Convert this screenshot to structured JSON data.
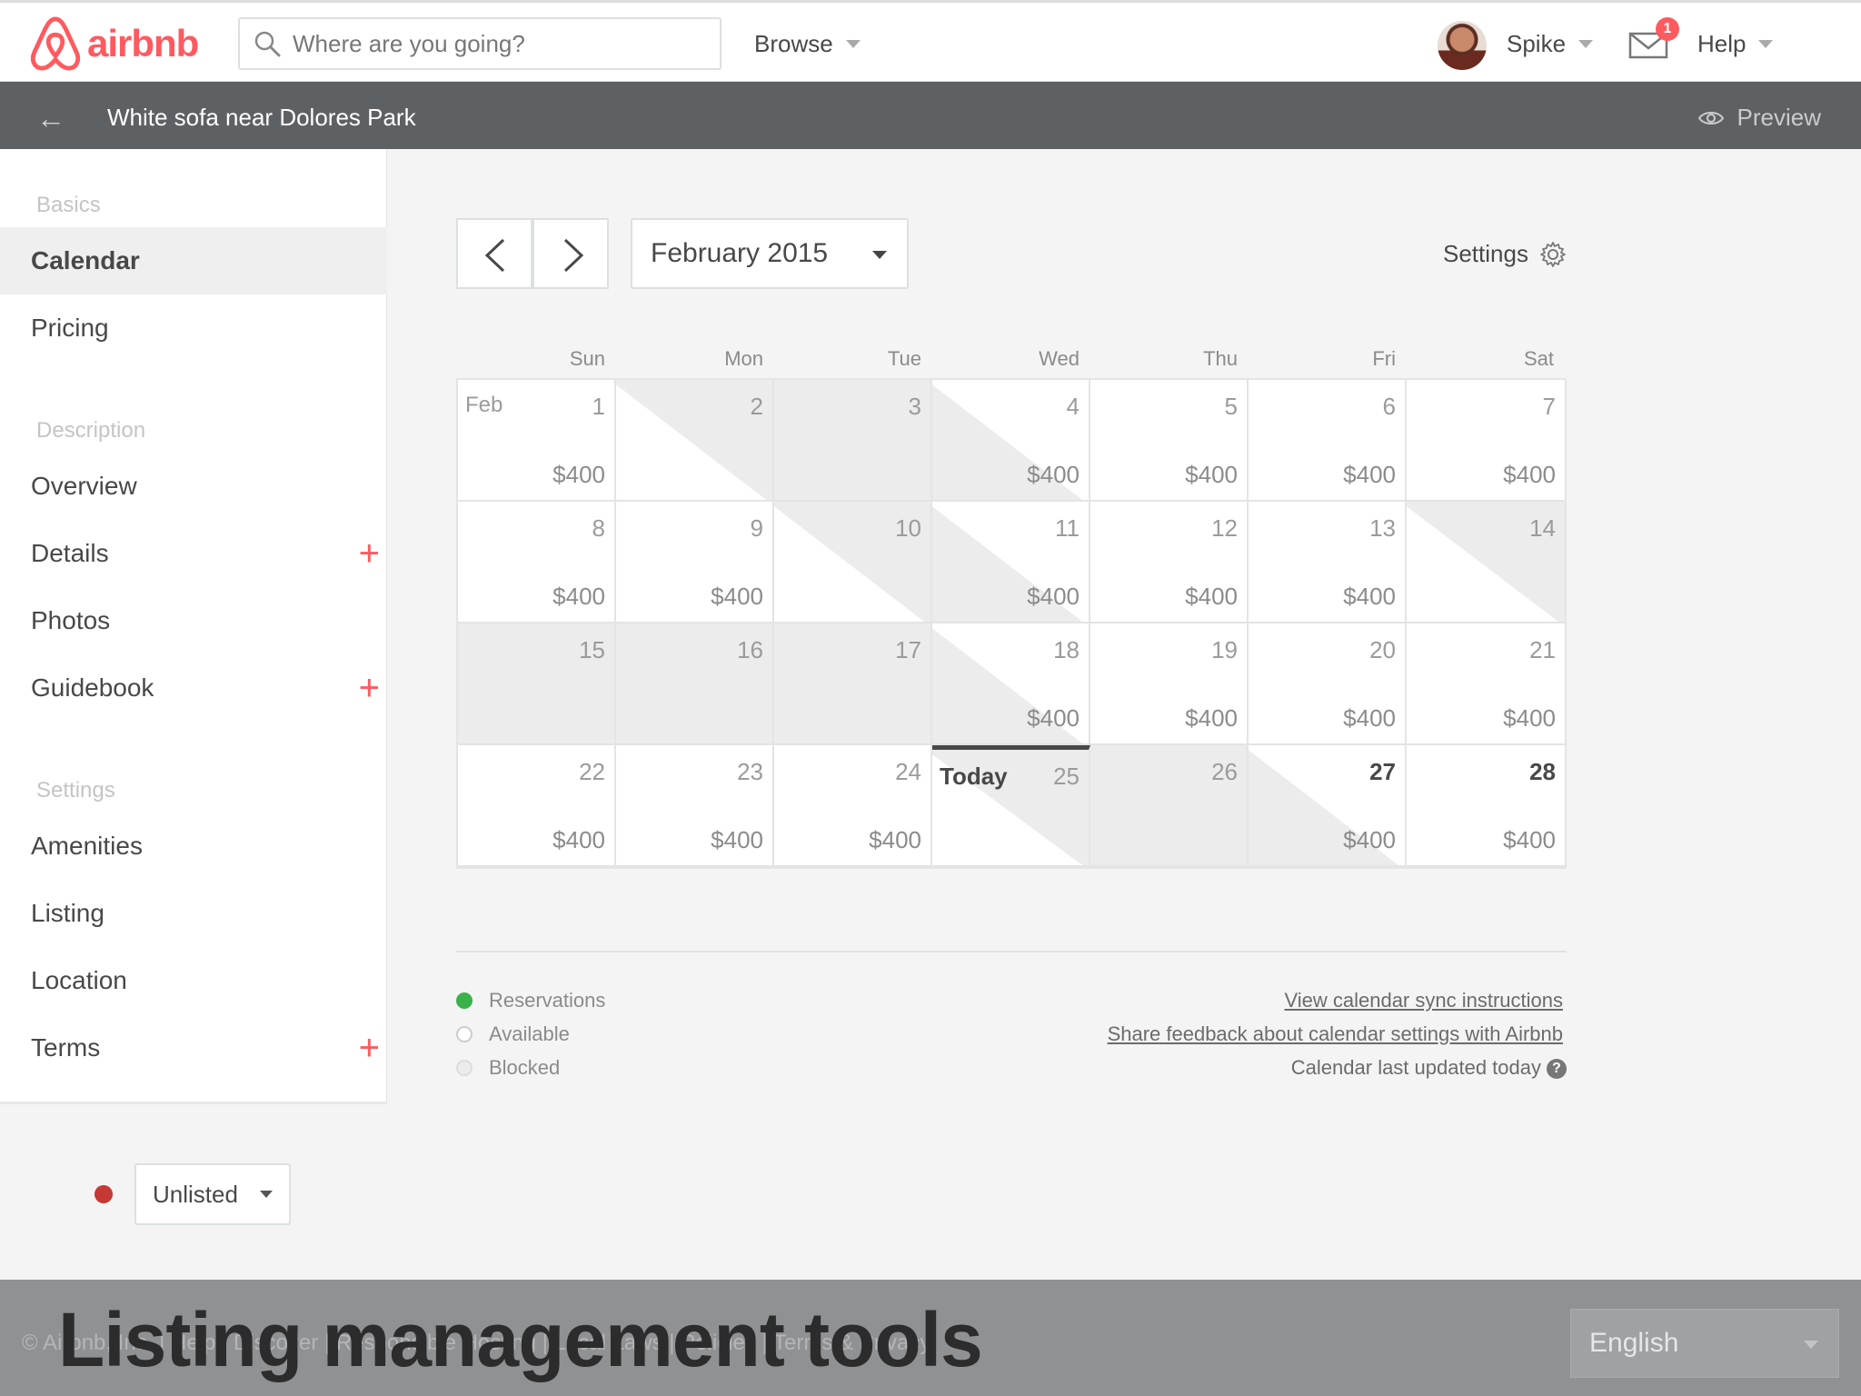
{
  "topnav": {
    "logo_text": "airbnb",
    "search_placeholder": "Where are you going?",
    "browse_label": "Browse",
    "user_name": "Spike",
    "mail_badge": "1",
    "help_label": "Help",
    "brand_color": "#ff5a5f"
  },
  "subheader": {
    "back_icon": "back-arrow-icon",
    "title": "White sofa near Dolores Park",
    "preview_label": "Preview"
  },
  "sidebar": {
    "sections": [
      {
        "heading": "Basics",
        "items": [
          "Calendar",
          "Pricing"
        ]
      },
      {
        "heading": "Description",
        "items": [
          "Overview",
          "Details",
          "Photos",
          "Guidebook"
        ]
      },
      {
        "heading": "Settings",
        "items": [
          "Amenities",
          "Listing",
          "Location",
          "Terms"
        ]
      }
    ],
    "active_item": "Calendar",
    "items_with_plus": [
      "Details",
      "Guidebook",
      "Terms"
    ],
    "status_label": "Unlisted",
    "status_color": "#c53834"
  },
  "calendar": {
    "month_label": "February 2015",
    "settings_label": "Settings",
    "weekdays": [
      "Sun",
      "Mon",
      "Tue",
      "Wed",
      "Thu",
      "Fri",
      "Sat"
    ],
    "month_abbrev": "Feb",
    "today_label": "Today",
    "days": [
      {
        "day": "1",
        "price": "$400",
        "state": "available"
      },
      {
        "day": "2",
        "price": "",
        "state": "diag-in"
      },
      {
        "day": "3",
        "price": "",
        "state": "blocked"
      },
      {
        "day": "4",
        "price": "$400",
        "state": "diag-out"
      },
      {
        "day": "5",
        "price": "$400",
        "state": "available"
      },
      {
        "day": "6",
        "price": "$400",
        "state": "available"
      },
      {
        "day": "7",
        "price": "$400",
        "state": "available"
      },
      {
        "day": "8",
        "price": "$400",
        "state": "available"
      },
      {
        "day": "9",
        "price": "$400",
        "state": "available"
      },
      {
        "day": "10",
        "price": "",
        "state": "diag-in"
      },
      {
        "day": "11",
        "price": "$400",
        "state": "diag-out"
      },
      {
        "day": "12",
        "price": "$400",
        "state": "available"
      },
      {
        "day": "13",
        "price": "$400",
        "state": "available"
      },
      {
        "day": "14",
        "price": "",
        "state": "diag-in"
      },
      {
        "day": "15",
        "price": "",
        "state": "blocked"
      },
      {
        "day": "16",
        "price": "",
        "state": "blocked"
      },
      {
        "day": "17",
        "price": "",
        "state": "blocked"
      },
      {
        "day": "18",
        "price": "$400",
        "state": "diag-out"
      },
      {
        "day": "19",
        "price": "$400",
        "state": "available"
      },
      {
        "day": "20",
        "price": "$400",
        "state": "available"
      },
      {
        "day": "21",
        "price": "$400",
        "state": "available"
      },
      {
        "day": "22",
        "price": "$400",
        "state": "available"
      },
      {
        "day": "23",
        "price": "$400",
        "state": "available"
      },
      {
        "day": "24",
        "price": "$400",
        "state": "available"
      },
      {
        "day": "25",
        "price": "",
        "state": "today"
      },
      {
        "day": "26",
        "price": "",
        "state": "blocked"
      },
      {
        "day": "27",
        "price": "$400",
        "state": "diag-out-bold"
      },
      {
        "day": "28",
        "price": "$400",
        "state": "bold"
      }
    ]
  },
  "legend": {
    "items": [
      {
        "label": "Reservations",
        "color": "#3ab24a"
      },
      {
        "label": "Available",
        "color": "#ffffff"
      },
      {
        "label": "Blocked",
        "color": "#ececec"
      }
    ],
    "sync_link": "View calendar sync instructions",
    "feedback_link": "Share feedback about calendar settings with Airbnb",
    "updated_text": "Calendar last updated today"
  },
  "footer": {
    "links_text": "© Airbnb, Inc. | Help | Discover | Responsible Hosting | Local Laws | Policies | Terms & Privacy",
    "language": "English"
  },
  "caption": "Listing management tools"
}
